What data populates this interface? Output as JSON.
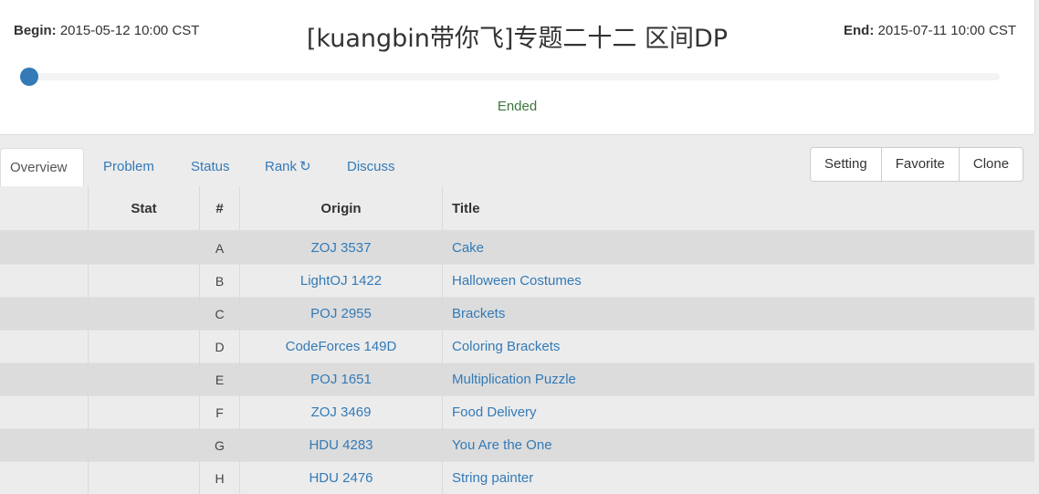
{
  "contest": {
    "begin_label": "Begin:",
    "begin_time": "2015-05-12 10:00 CST",
    "end_label": "End:",
    "end_time": "2015-07-11 10:00 CST",
    "title": "[kuangbin带你飞]专题二十二 区间DP",
    "status": "Ended",
    "progress": 0
  },
  "tabs": [
    {
      "label": "Overview",
      "active": true
    },
    {
      "label": "Problem"
    },
    {
      "label": "Status"
    },
    {
      "label": "Rank",
      "icon": "refresh-icon"
    },
    {
      "label": "Discuss"
    }
  ],
  "buttons": {
    "setting": "Setting",
    "favorite": "Favorite",
    "clone": "Clone"
  },
  "table": {
    "headers": {
      "stat": "Stat",
      "num": "#",
      "origin": "Origin",
      "title": "Title"
    },
    "rows": [
      {
        "num": "A",
        "origin": "ZOJ 3537",
        "title": "Cake"
      },
      {
        "num": "B",
        "origin": "LightOJ 1422",
        "title": "Halloween Costumes"
      },
      {
        "num": "C",
        "origin": "POJ 2955",
        "title": "Brackets"
      },
      {
        "num": "D",
        "origin": "CodeForces 149D",
        "title": "Coloring Brackets"
      },
      {
        "num": "E",
        "origin": "POJ 1651",
        "title": "Multiplication Puzzle"
      },
      {
        "num": "F",
        "origin": "ZOJ 3469",
        "title": "Food Delivery"
      },
      {
        "num": "G",
        "origin": "HDU 4283",
        "title": "You Are the One"
      },
      {
        "num": "H",
        "origin": "HDU 2476",
        "title": "String painter"
      }
    ]
  },
  "colors": {
    "link": "#337ab7",
    "status_ended": "#3c763d",
    "progress_handle": "#337ab7"
  }
}
